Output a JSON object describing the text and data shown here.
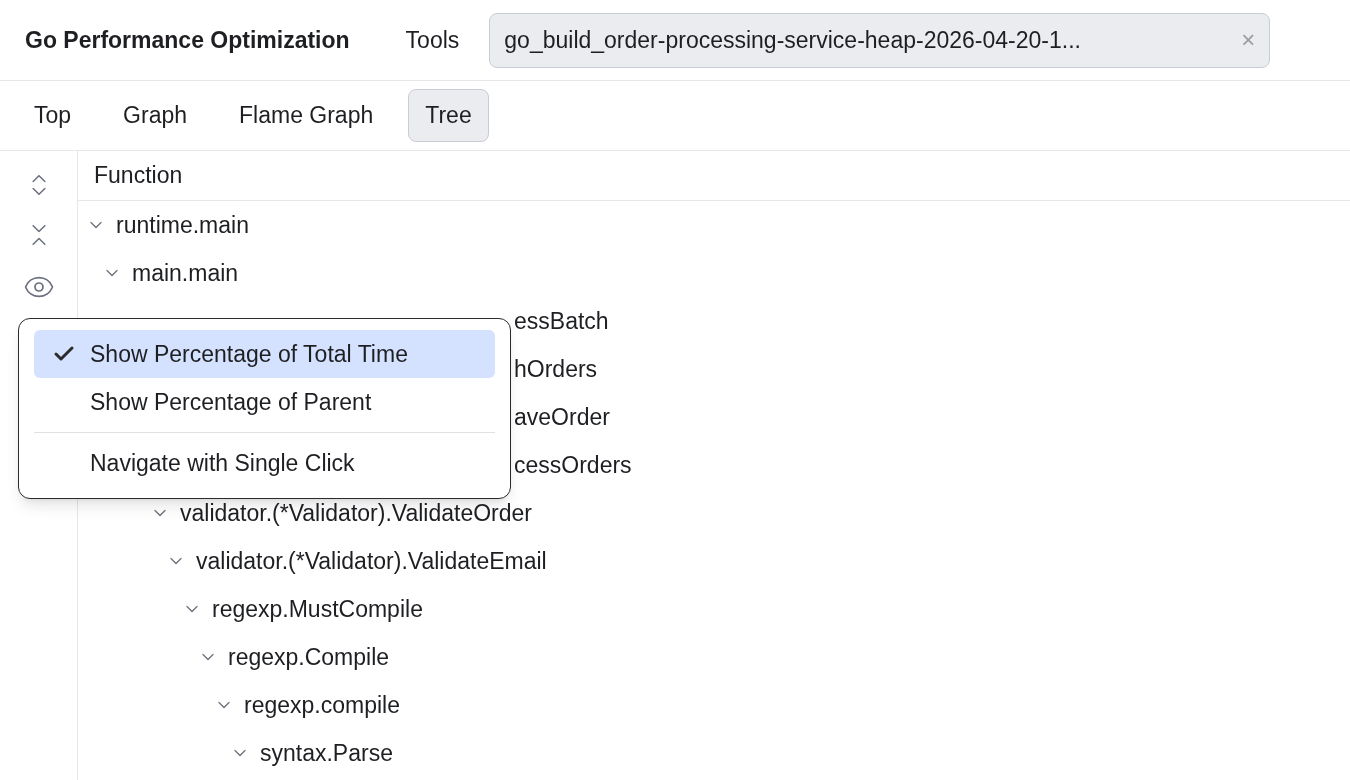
{
  "header": {
    "title": "Go Performance Optimization",
    "tools": "Tools",
    "file_tab": {
      "label": "go_build_order-processing-service-heap-2026-04-20-1...",
      "close": "×"
    }
  },
  "tabs": [
    {
      "label": "Top",
      "selected": false
    },
    {
      "label": "Graph",
      "selected": false
    },
    {
      "label": "Flame Graph",
      "selected": false
    },
    {
      "label": "Tree",
      "selected": true
    }
  ],
  "tree": {
    "column": "Function",
    "rows": [
      {
        "kind": "node",
        "label": "runtime.main",
        "expanded": true,
        "children": [
          {
            "kind": "node",
            "label": "main.main",
            "expanded": true,
            "children": [
              {
                "kind": "clipped",
                "label": "essBatch",
                "children": [
                  {
                    "kind": "clipped",
                    "label": "hOrders"
                  },
                  {
                    "kind": "clipped",
                    "label": "aveOrder"
                  },
                  {
                    "kind": "clipped",
                    "label": "cessOrders",
                    "children": [
                      {
                        "kind": "node",
                        "label": "validator.(*Validator).ValidateOrder",
                        "expanded": true,
                        "children": [
                          {
                            "kind": "node",
                            "label": "validator.(*Validator).ValidateEmail",
                            "expanded": true,
                            "children": [
                              {
                                "kind": "node",
                                "label": "regexp.MustCompile",
                                "expanded": true,
                                "children": [
                                  {
                                    "kind": "node",
                                    "label": "regexp.Compile",
                                    "expanded": true,
                                    "children": [
                                      {
                                        "kind": "node",
                                        "label": "regexp.compile",
                                        "expanded": true,
                                        "children": [
                                          {
                                            "kind": "node",
                                            "label": "syntax.Parse",
                                            "expanded": true
                                          }
                                        ]
                                      }
                                    ]
                                  }
                                ]
                              }
                            ]
                          }
                        ]
                      }
                    ]
                  }
                ]
              }
            ]
          }
        ]
      }
    ]
  },
  "menu": {
    "items": [
      {
        "kind": "option",
        "label": "Show Percentage of Total Time",
        "checked": true,
        "selected": true
      },
      {
        "kind": "option",
        "label": "Show Percentage of Parent",
        "checked": false,
        "selected": false
      },
      {
        "kind": "separator"
      },
      {
        "kind": "option",
        "label": "Navigate with Single Click",
        "checked": false,
        "selected": false
      }
    ]
  }
}
